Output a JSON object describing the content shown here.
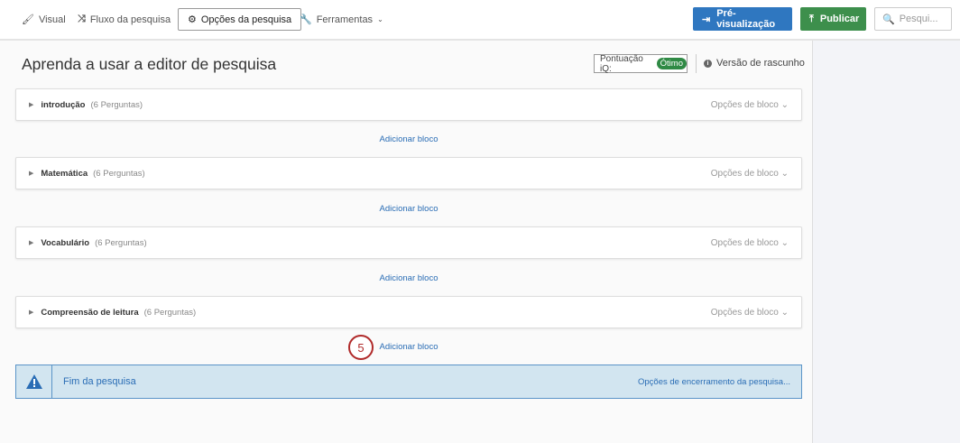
{
  "nav": {
    "visual": "Visual",
    "flow": "Fluxo da pesquisa",
    "options": "Opções da pesquisa",
    "tools": "Ferramentas"
  },
  "actions": {
    "preview": "Pré-visualização",
    "publish": "Publicar",
    "search_placeholder": "Pesqui..."
  },
  "colors": {
    "preview": "#2f77c0",
    "publish": "#3d8f4c",
    "link": "#2a6db5"
  },
  "title": "Aprenda a usar a editor de pesquisa",
  "iq": {
    "label": "Pontuação iQ:",
    "value": "Ótimo"
  },
  "version": "Versão de rascunho",
  "blocks": [
    {
      "name": "introdução",
      "count": "(6 Perguntas)",
      "options": "Opções de bloco"
    },
    {
      "name": "Matemática",
      "count": "(6 Perguntas)",
      "options": "Opções de bloco"
    },
    {
      "name": "Vocabulário",
      "count": "(6 Perguntas)",
      "options": "Opções de bloco"
    },
    {
      "name": "Compreensão de leitura",
      "count": "(6 Perguntas)",
      "options": "Opções de bloco"
    }
  ],
  "add_block": "Adicionar bloco",
  "step_marker": "5",
  "end": {
    "label": "Fim da pesquisa",
    "options": "Opções de encerramento da pesquisa..."
  }
}
